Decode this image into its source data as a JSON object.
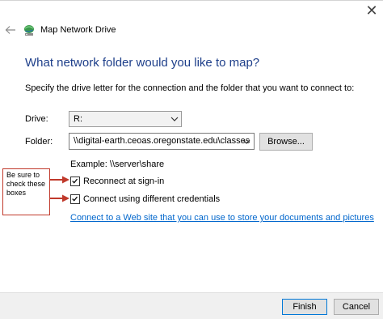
{
  "window": {
    "title": "Map Network Drive",
    "close_glyph": "✕"
  },
  "icons": {
    "back": "back-arrow-icon",
    "network_drive": "network-drive-icon",
    "dropdown": "chevron-down-icon",
    "check": "checkmark-icon"
  },
  "main": {
    "heading": "What network folder would you like to map?",
    "instruction": "Specify the drive letter for the connection and the folder that you want to connect to:",
    "drive": {
      "label": "Drive:",
      "value": "R:"
    },
    "folder": {
      "label": "Folder:",
      "value": "\\\\digital-earth.ceoas.oregonstate.edu\\classes"
    },
    "browse_label": "Browse...",
    "example": "Example: \\\\server\\share",
    "reconnect": {
      "label": "Reconnect at sign-in",
      "checked": true
    },
    "credentials": {
      "label": "Connect using different credentials",
      "checked": true
    },
    "link": "Connect to a Web site that you can use to store your documents and pictures"
  },
  "annotation": {
    "line1": "Be sure to",
    "line2": "check these",
    "line3": "boxes",
    "color": "#c0392b"
  },
  "footer": {
    "finish_label": "Finish",
    "cancel_label": "Cancel"
  },
  "colors": {
    "heading": "#1e3f8a",
    "link": "#0066cc",
    "default_button_border": "#0078d7"
  }
}
